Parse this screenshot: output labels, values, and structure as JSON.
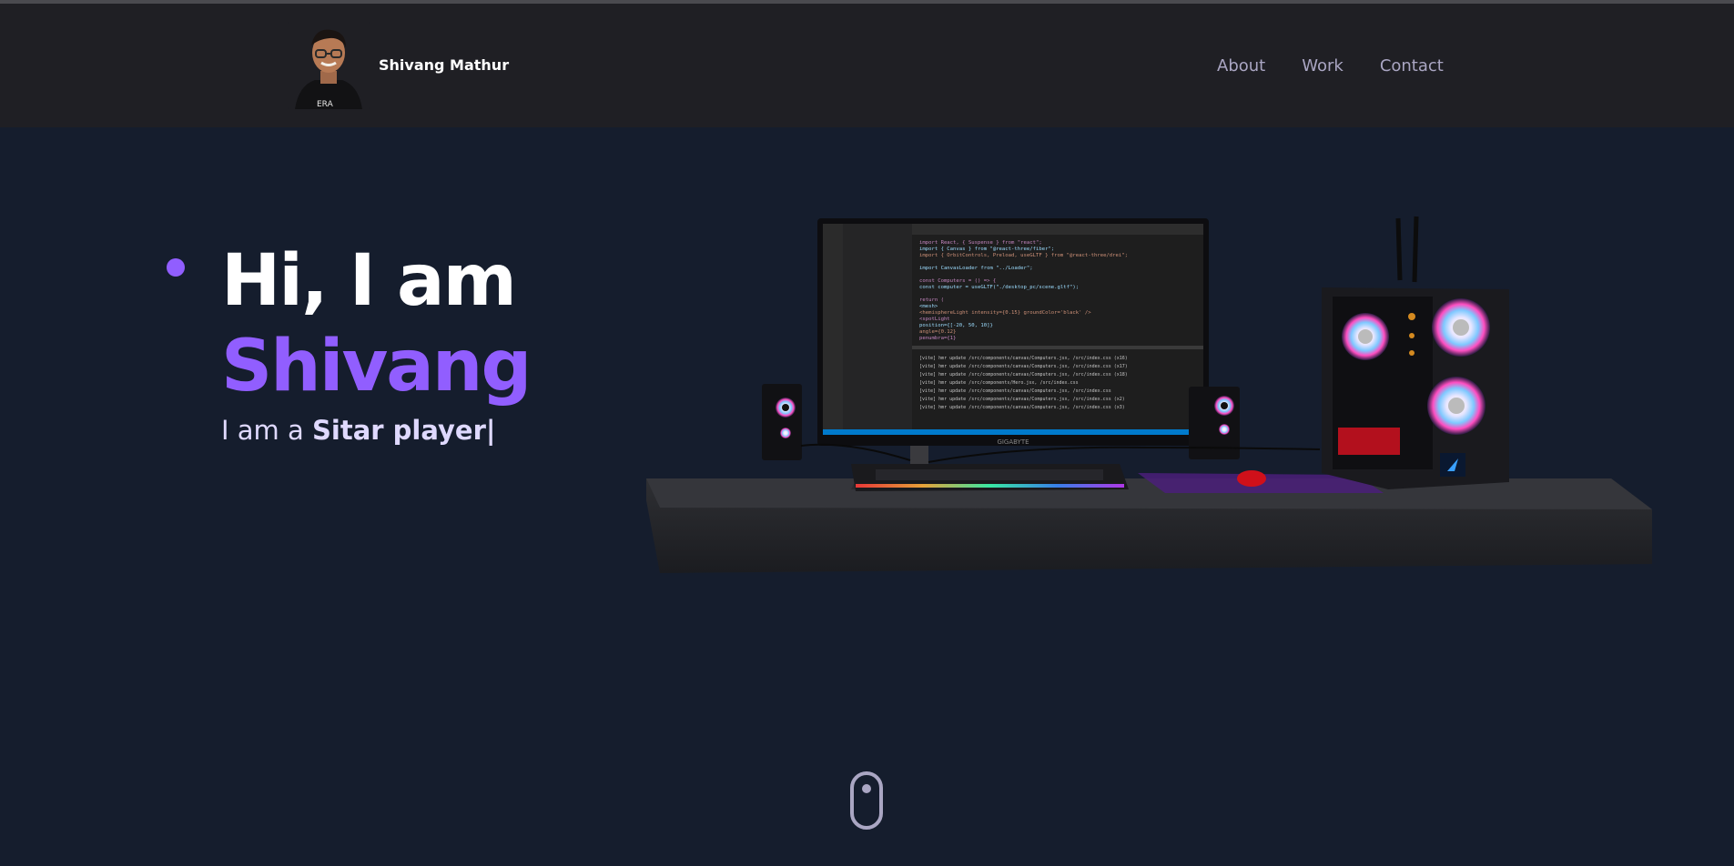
{
  "navbar": {
    "brand_name": "Shivang Mathur",
    "links": [
      {
        "label": "About"
      },
      {
        "label": "Work"
      },
      {
        "label": "Contact"
      }
    ]
  },
  "hero": {
    "greeting": "Hi, I am",
    "name": "Shivang",
    "subtitle_prefix": "I am a ",
    "subtitle_role": "Sitar player|"
  },
  "desktop_scene": {
    "monitor_brand": "GIGABYTE",
    "code_lines": [
      "import React, { Suspense } from \"react\";",
      "import { Canvas } from \"@react-three/fiber\";",
      "import { OrbitControls, Preload, useGLTF } from \"@react-three/drei\";",
      "",
      "import CanvasLoader from \"../Loader\";",
      "",
      "const Computers = () => {",
      "  const computer = useGLTF(\"./desktop_pc/scene.gltf\");",
      "",
      "  return (",
      "    <mesh>",
      "      <hemisphereLight intensity={0.15} groundColor='black' />",
      "      <spotLight",
      "        position={[-20, 50, 10]}",
      "        angle={0.12}",
      "        penumbra={1}"
    ],
    "terminal_lines": [
      "[vite] hmr update /src/components/canvas/Computers.jsx, /src/index.css (x16)",
      "[vite] hmr update /src/components/canvas/Computers.jsx, /src/index.css (x17)",
      "[vite] hmr update /src/components/canvas/Computers.jsx, /src/index.css (x18)",
      "[vite] hmr update /src/components/Hero.jsx, /src/index.css",
      "[vite] hmr update /src/components/canvas/Computers.jsx, /src/index.css",
      "[vite] hmr update /src/components/canvas/Computers.jsx, /src/index.css (x2)",
      "[vite] hmr update /src/components/canvas/Computers.jsx, /src/index.css (x3)"
    ]
  },
  "colors": {
    "accent": "#915eff",
    "background": "#151d2d",
    "navbar": "#1f1f24",
    "secondary_text": "#aaa6c3"
  },
  "icons": {
    "scroll": "mouse-scroll-icon"
  }
}
